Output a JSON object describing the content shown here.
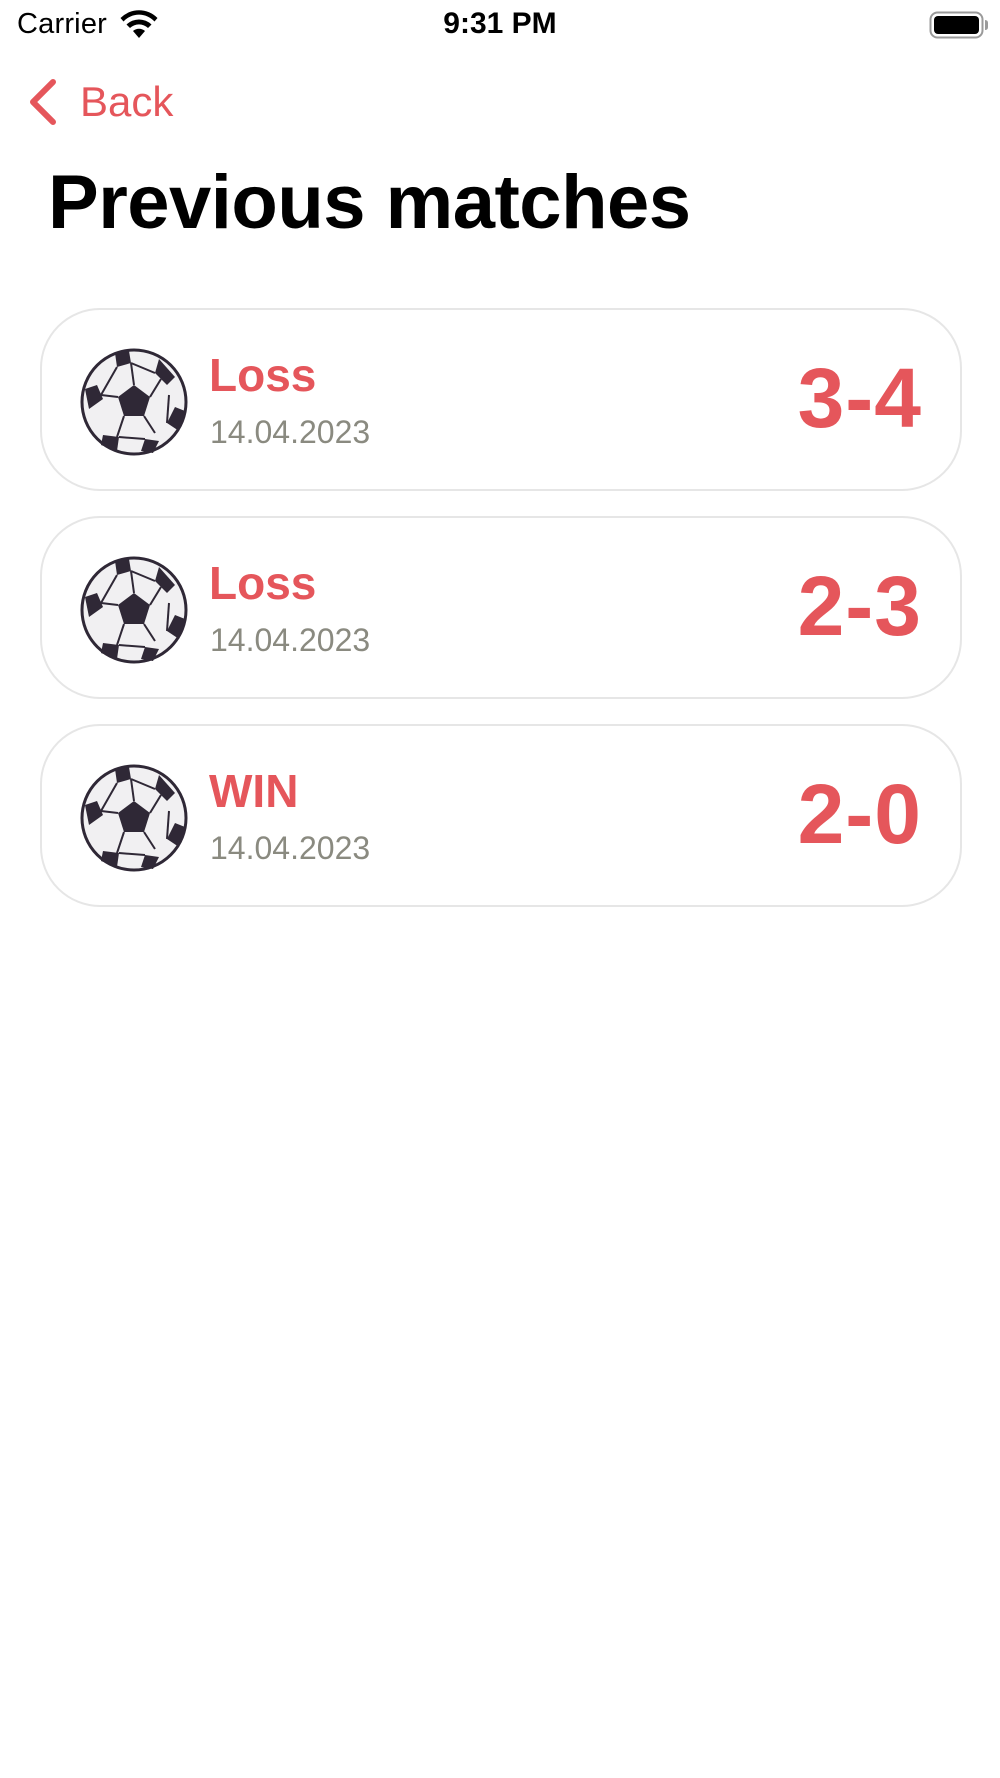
{
  "status_bar": {
    "carrier": "Carrier",
    "time": "9:31 PM"
  },
  "nav": {
    "back_label": "Back"
  },
  "page": {
    "title": "Previous matches"
  },
  "colors": {
    "accent": "#e5565b",
    "date_text": "#8a8a80",
    "card_border": "#e6e6e6"
  },
  "matches": [
    {
      "result": "Loss",
      "date": "14.04.2023",
      "score": "3-4",
      "icon": "soccer-ball-icon"
    },
    {
      "result": "Loss",
      "date": "14.04.2023",
      "score": "2-3",
      "icon": "soccer-ball-icon"
    },
    {
      "result": "WIN",
      "date": "14.04.2023",
      "score": "2-0",
      "icon": "soccer-ball-icon"
    }
  ]
}
